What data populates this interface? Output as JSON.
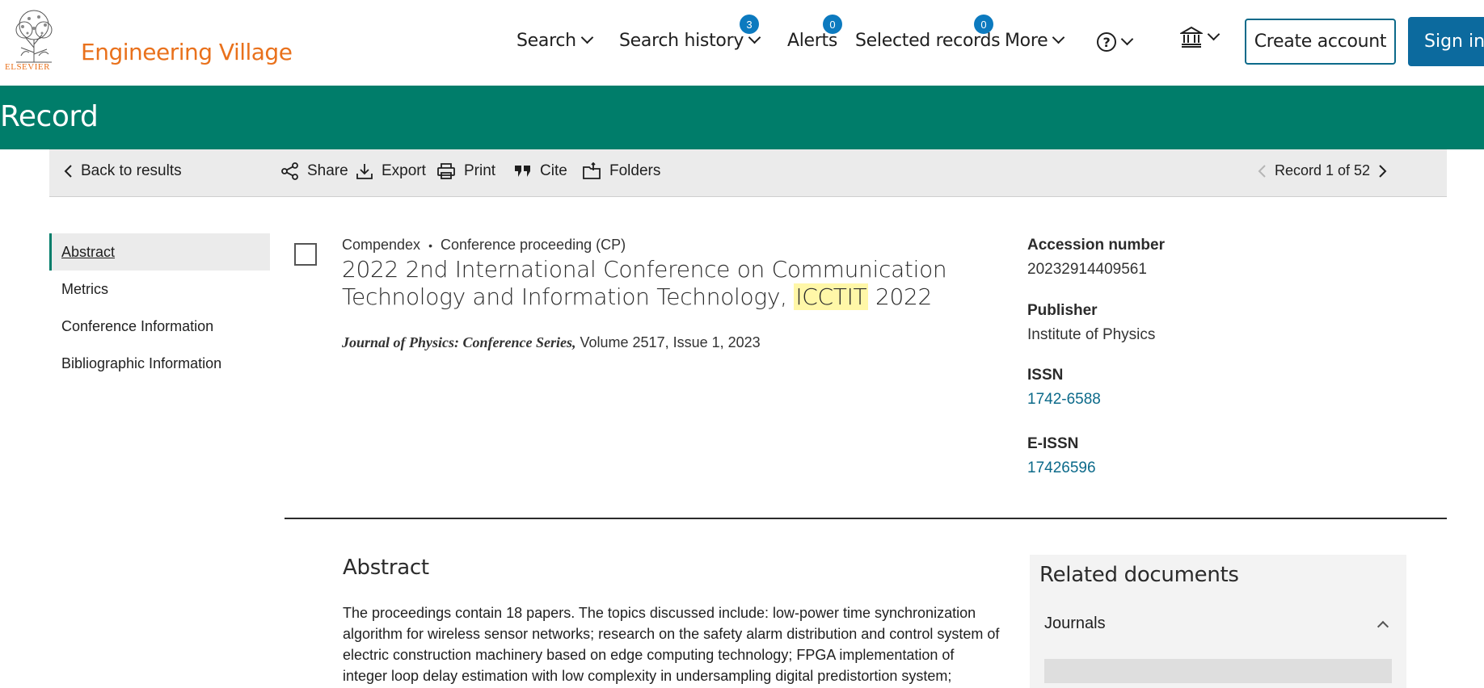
{
  "header": {
    "brand_label": "Engineering Village",
    "publisher_logo_text": "ELSEVIER",
    "nav": {
      "search_label": "Search",
      "history_label": "Search history",
      "history_count": "3",
      "alerts_label": "Alerts",
      "alerts_count": "0",
      "selected_label": "Selected records",
      "selected_count": "0",
      "more_label": "More"
    },
    "create_account_label": "Create account",
    "signin_label": "Sign in"
  },
  "band": {
    "title": "Record"
  },
  "toolbar": {
    "back_label": "Back to results",
    "share_label": "Share",
    "export_label": "Export",
    "print_label": "Print",
    "cite_label": "Cite",
    "folders_label": "Folders",
    "record_position": "Record 1 of 52"
  },
  "sidenav": {
    "items": [
      {
        "label": "Abstract"
      },
      {
        "label": "Metrics"
      },
      {
        "label": "Conference Information"
      },
      {
        "label": "Bibliographic Information"
      }
    ]
  },
  "record": {
    "database": "Compendex",
    "doc_type": "Conference proceeding (CP)",
    "title_before": "2022 2nd International Conference on Communication Technology and Information Technology, ",
    "title_highlight": "ICCTIT",
    "title_after": " 2022",
    "journal": "Journal of Physics: Conference Series,",
    "volume_issue": " Volume 2517, Issue 1, 2023"
  },
  "details": {
    "accession_label": "Accession number",
    "accession_value": "20232914409561",
    "publisher_label": "Publisher",
    "publisher_value": "Institute of Physics",
    "issn_label": "ISSN",
    "issn_value": "1742-6588",
    "eissn_label": "E-ISSN",
    "eissn_value": "17426596"
  },
  "abstract": {
    "heading": "Abstract",
    "text": "The proceedings contain 18 papers. The topics discussed include: low-power time synchronization algorithm for wireless sensor networks; research on the safety alarm distribution and control system of electric construction machinery based on edge computing technology; FPGA implementation of integer loop delay estimation with low complexity in undersampling digital predistortion system; research on"
  },
  "related": {
    "title": "Related documents",
    "journals_label": "Journals"
  },
  "colors": {
    "brand_orange": "#e9711c",
    "band_green": "#007d6a",
    "link_blue": "#0c6a8a",
    "badge_blue": "#0c7abf",
    "highlight_yellow": "#fff7a8"
  }
}
